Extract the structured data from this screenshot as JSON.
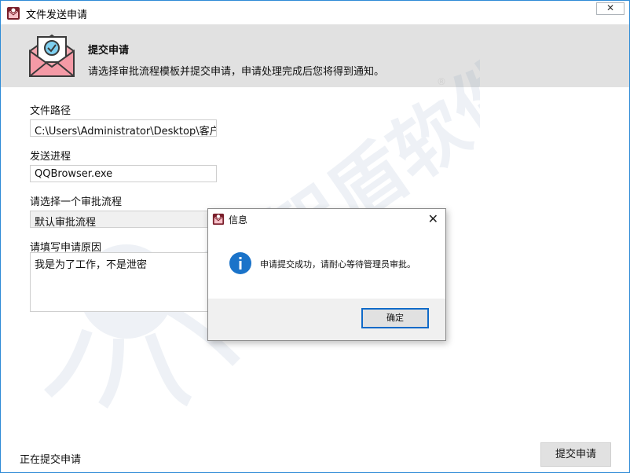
{
  "window": {
    "title": "文件发送申请",
    "close_label": "✕"
  },
  "header": {
    "title": "提交申请",
    "description": "请选择审批流程模板并提交申请，申请处理完成后您将得到通知。"
  },
  "form": {
    "path_label": "文件路径",
    "path_value": "C:\\Users\\Administrator\\Desktop\\客户名",
    "process_label": "发送进程",
    "process_value": "QQBrowser.exe",
    "flow_label": "请选择一个审批流程",
    "flow_value": "默认审批流程",
    "reason_label": "请填写申请原因",
    "reason_value": "我是为了工作，不是泄密"
  },
  "status": {
    "text": "正在提交申请"
  },
  "actions": {
    "submit_label": "提交申请"
  },
  "dialog": {
    "title": "信息",
    "close_label": "✕",
    "message": "申请提交成功，请耐心等待管理员审批。",
    "ok_label": "确定"
  },
  "watermark": {
    "text": "域智盾软件",
    "mark": "®"
  },
  "colors": {
    "accent": "#0f6ac8",
    "header_bg": "#e1e1e1",
    "info_blue": "#1a73c9"
  }
}
